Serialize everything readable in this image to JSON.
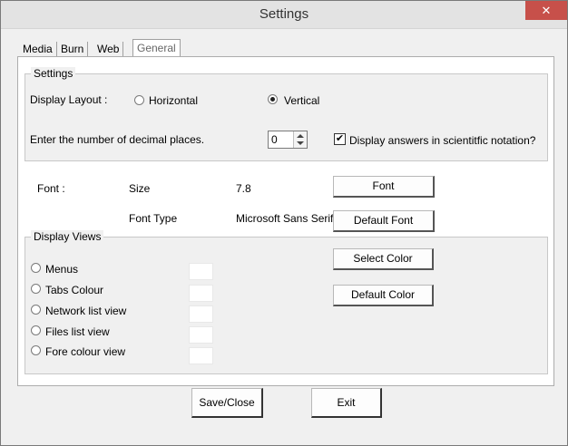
{
  "window": {
    "title": "Settings",
    "close_glyph": "✕"
  },
  "tabs": [
    {
      "label": "Media"
    },
    {
      "label": "Burn"
    },
    {
      "label": "Web"
    },
    {
      "label": "General",
      "active": true
    }
  ],
  "settings_group": {
    "title": "Settings",
    "display_layout_label": "Display Layout :",
    "layout_options": [
      {
        "label": "Horizontal",
        "selected": false
      },
      {
        "label": "Vertical",
        "selected": true
      }
    ],
    "decimal_label": "Enter the number of decimal places.",
    "decimal_value": "0",
    "scientific_label": "Display answers in scientitfic notation?",
    "scientific_checked": true,
    "check_glyph": "✔"
  },
  "font_section": {
    "font_label": "Font :",
    "size_label": "Size",
    "size_value": "7.8",
    "type_label": "Font Type",
    "type_value": "Microsoft Sans Serif",
    "font_button": "Font",
    "default_font_button": "Default Font"
  },
  "display_views": {
    "title": "Display Views",
    "items": [
      {
        "label": "Menus",
        "swatch_color": "#ffffff"
      },
      {
        "label": "Tabs Colour",
        "swatch_color": "#ffffff"
      },
      {
        "label": "Network list view",
        "swatch_color": "#ffffff"
      },
      {
        "label": "Files list view",
        "swatch_color": "#ffffff"
      },
      {
        "label": "Fore colour view",
        "swatch_color": "#ffffff"
      }
    ],
    "select_color_button": "Select Color",
    "default_color_button": "Default Color"
  },
  "footer": {
    "save_close": "Save/Close",
    "exit": "Exit"
  }
}
